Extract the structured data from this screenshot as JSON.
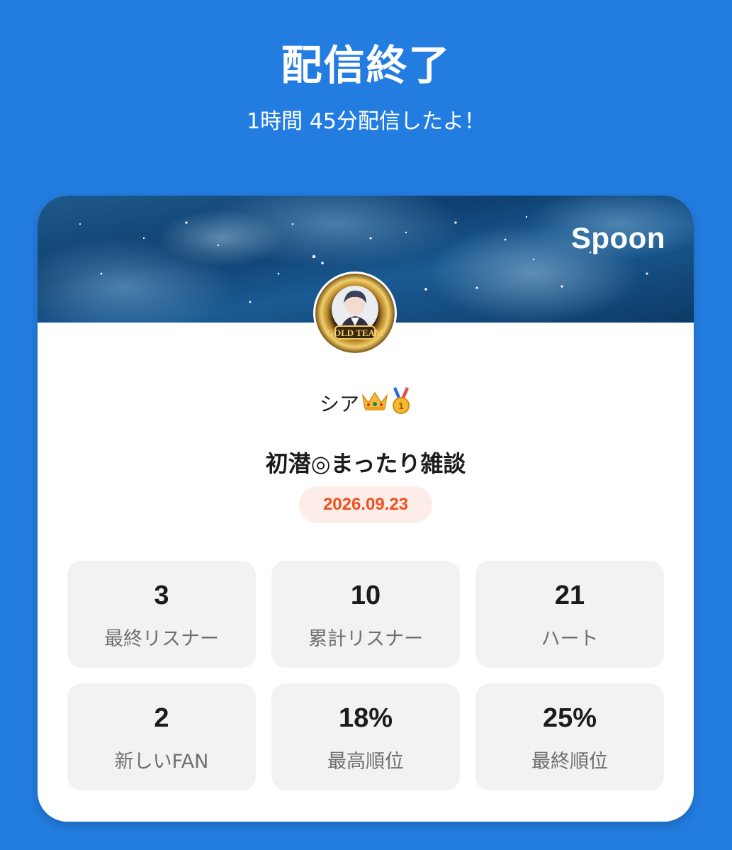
{
  "header": {
    "title": "配信終了",
    "subtitle": "1時間 45分配信したよ！"
  },
  "card": {
    "brand": "Spoon",
    "avatar_label": "GOLD TEAM",
    "user": {
      "name": "シア",
      "badges": [
        "crown-icon",
        "gold-medal-icon"
      ]
    },
    "stream_title": "初潜◎まったり雑談",
    "date": "2026.09.23",
    "stats": [
      {
        "value": "3",
        "label": "最終リスナー"
      },
      {
        "value": "10",
        "label": "累計リスナー"
      },
      {
        "value": "21",
        "label": "ハート"
      },
      {
        "value": "2",
        "label": "新しいFAN"
      },
      {
        "value": "18%",
        "label": "最高順位"
      },
      {
        "value": "25%",
        "label": "最終順位"
      }
    ]
  },
  "colors": {
    "background": "#237DE1",
    "date_text": "#F04F1E",
    "date_pill": "#FDEDE8",
    "stat_tile": "#F2F2F2"
  }
}
